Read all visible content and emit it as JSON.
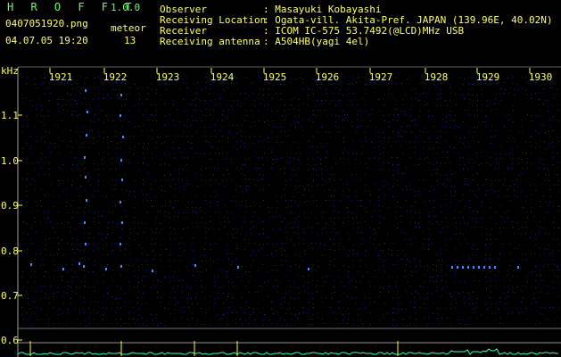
{
  "header": {
    "app_name": "H R O F F T",
    "version": "1.0.0",
    "file_name": "0407051920.png",
    "datetime": "04.07.05 19:20",
    "meteor_label": "meteor",
    "meteor_count": "13"
  },
  "info": {
    "observer_label": "Observer",
    "observer_value": ": Masayuki Kobayashi",
    "location_label": "Receiving Location",
    "location_value": ": Ogata-vill. Akita-Pref. JAPAN (139.96E, 40.02N)",
    "receiver_label": "Receiver",
    "receiver_value": ": ICOM IC-575 53.7492(@LCD)MHz USB",
    "antenna_label": "Receiving antenna",
    "antenna_value": ": A504HB(yagi 4el)"
  },
  "spectrogram": {
    "unit_label": "kHz",
    "time_labels": [
      "1921",
      "1922",
      "1923",
      "1924",
      "1925",
      "1926",
      "1927",
      "1928",
      "1929",
      "1930"
    ],
    "freq_labels": [
      "1.1",
      "1.0",
      "0.9",
      "0.8",
      "0.7",
      "0.6"
    ],
    "colors": {
      "text": "#ffff66",
      "title": "#66ff66",
      "background": "#000000",
      "noise": "#202060",
      "echo": "#4a8cff",
      "level": "#33ffcc",
      "peak": "#ffff33"
    }
  }
}
